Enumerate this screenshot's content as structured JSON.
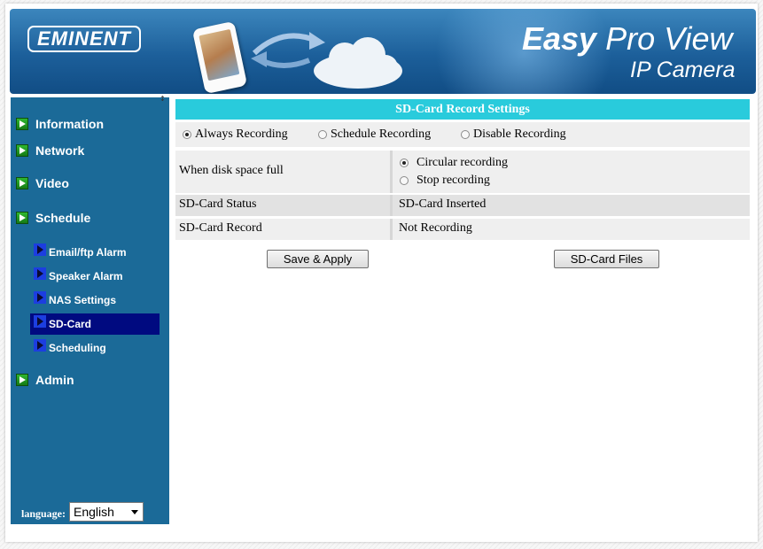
{
  "banner": {
    "brand": "EMINENT",
    "title_bold": "Easy",
    "title_rest": " Pro View",
    "subtitle": "IP Camera"
  },
  "sidebar": {
    "main_items": [
      {
        "label": "Information"
      },
      {
        "label": "Network"
      },
      {
        "label": "Video"
      },
      {
        "label": "Schedule"
      },
      {
        "label": "Admin"
      }
    ],
    "sub_items": [
      {
        "label": "Email/ftp Alarm"
      },
      {
        "label": "Speaker Alarm"
      },
      {
        "label": "NAS Settings"
      },
      {
        "label": "SD-Card",
        "active": true
      },
      {
        "label": "Scheduling"
      }
    ],
    "language_label": "language:",
    "language_value": "English"
  },
  "main": {
    "section_title": "SD-Card Record Settings",
    "record_modes": [
      {
        "label": "Always Recording",
        "selected": true
      },
      {
        "label": "Schedule Recording",
        "selected": false
      },
      {
        "label": "Disable Recording",
        "selected": false
      }
    ],
    "disk_full": {
      "label": "When disk space full",
      "options": [
        {
          "label": "Circular recording",
          "selected": true
        },
        {
          "label": "Stop recording",
          "selected": false
        }
      ]
    },
    "status": {
      "label": "SD-Card Status",
      "value": "SD-Card Inserted"
    },
    "record": {
      "label": "SD-Card Record",
      "value": "Not Recording"
    },
    "buttons": {
      "save": "Save & Apply",
      "files": "SD-Card Files"
    }
  },
  "colors": {
    "header_accent": "#29cbdc",
    "sidebar_bg": "#1b6a98",
    "active_nav_bg": "#000a80"
  }
}
